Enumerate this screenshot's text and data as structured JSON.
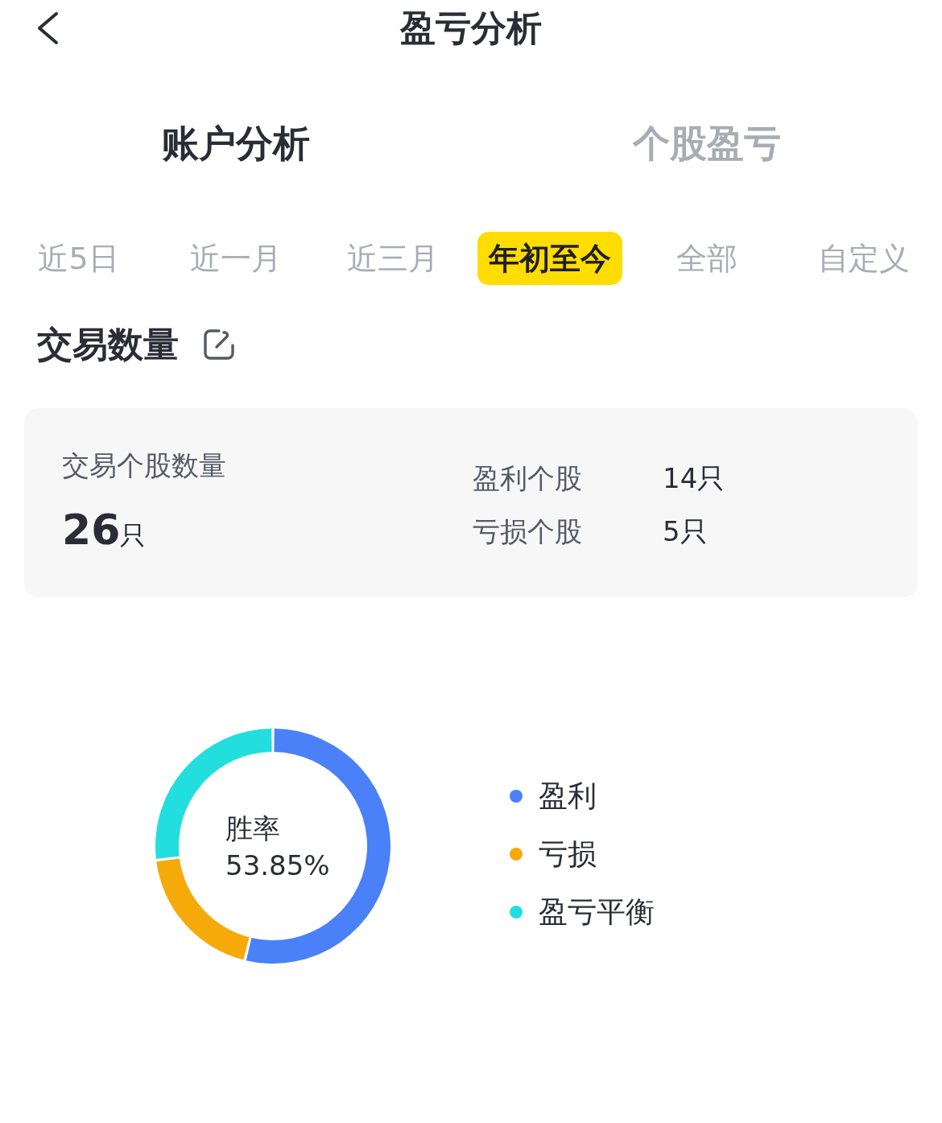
{
  "header": {
    "title": "盈亏分析"
  },
  "tabs": [
    {
      "label": "账户分析",
      "selected": true
    },
    {
      "label": "个股盈亏",
      "selected": false
    }
  ],
  "periods": [
    {
      "label": "近5日",
      "selected": false
    },
    {
      "label": "近一月",
      "selected": false
    },
    {
      "label": "近三月",
      "selected": false
    },
    {
      "label": "年初至今",
      "selected": true
    },
    {
      "label": "全部",
      "selected": false
    },
    {
      "label": "自定义",
      "selected": false
    }
  ],
  "trade_count": {
    "title": "交易数量",
    "total_label": "交易个股数量",
    "total_value": "26",
    "total_unit": "只",
    "stats": [
      {
        "label": "盈利个股",
        "value": "14只"
      },
      {
        "label": "亏损个股",
        "value": "5只"
      }
    ]
  },
  "win_rate": {
    "center_label": "胜率",
    "center_value": "53.85%",
    "legend": [
      {
        "label": "盈利",
        "color": "#4a80f8"
      },
      {
        "label": "亏损",
        "color": "#f5aa0a"
      },
      {
        "label": "盈亏平衡",
        "color": "#22dede"
      }
    ],
    "chart_data": {
      "type": "donut",
      "values": [
        53.85,
        19.23,
        26.92
      ]
    }
  }
}
